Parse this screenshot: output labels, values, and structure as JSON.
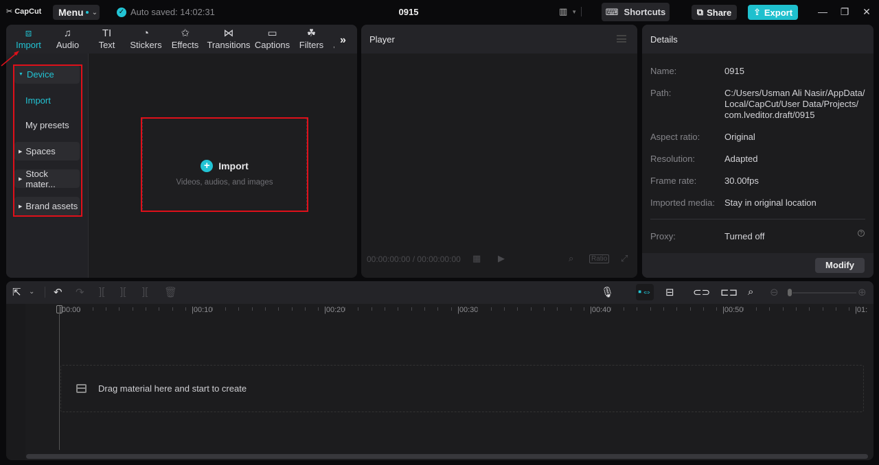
{
  "titlebar": {
    "logo": "CapCut",
    "menu_label": "Menu",
    "autosave": "Auto saved: 14:02:31",
    "project_title": "0915",
    "shortcuts_label": "Shortcuts",
    "share_label": "Share",
    "export_label": "Export"
  },
  "media": {
    "tabs": [
      {
        "label": "Import",
        "icon": "▶",
        "active": true
      },
      {
        "label": "Audio",
        "icon": "♪"
      },
      {
        "label": "Text",
        "icon": "TI"
      },
      {
        "label": "Stickers",
        "icon": "◔"
      },
      {
        "label": "Effects",
        "icon": "✩"
      },
      {
        "label": "Transitions",
        "icon": "⋈"
      },
      {
        "label": "Captions",
        "icon": "▭"
      },
      {
        "label": "Filters",
        "icon": "☘"
      }
    ],
    "more": "»",
    "sidebar": {
      "device": "Device",
      "import": "Import",
      "presets": "My presets",
      "spaces": "Spaces",
      "stock": "Stock mater...",
      "brand": "Brand assets"
    },
    "dropzone": {
      "title": "Import",
      "subtitle": "Videos, audios, and images"
    }
  },
  "player": {
    "title": "Player",
    "timecode": "00:00:00:00 / 00:00:00:00",
    "ratio_label": "Ratio"
  },
  "details": {
    "title": "Details",
    "rows": [
      {
        "label": "Name:",
        "value": "0915"
      },
      {
        "label": "Path:",
        "value": "C:/Users/Usman Ali Nasir/AppData/ Local/CapCut/User Data/Projects/ com.lveditor.draft/0915"
      },
      {
        "label": "Aspect ratio:",
        "value": "Original"
      },
      {
        "label": "Resolution:",
        "value": "Adapted"
      },
      {
        "label": "Frame rate:",
        "value": "30.00fps"
      },
      {
        "label": "Imported media:",
        "value": "Stay in original location"
      },
      {
        "label": "Proxy:",
        "value": "Turned off"
      }
    ],
    "modify_label": "Modify"
  },
  "timeline": {
    "ruler_labels": [
      "|00:00",
      "|00:10",
      "|00:20",
      "|00:30",
      "|00:40",
      "|00:50",
      "|01:"
    ],
    "drop_text": "Drag material here and start to create"
  },
  "colors": {
    "accent": "#22c4d4",
    "annotation_red": "#e0101a"
  }
}
